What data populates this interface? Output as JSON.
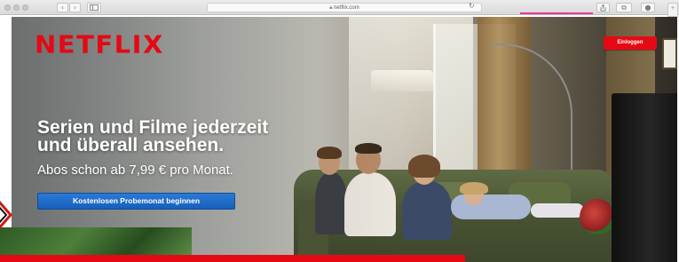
{
  "browser": {
    "url": "netflix.com",
    "back_icon": "chevron-left-icon",
    "forward_icon": "chevron-right-icon",
    "sidebar_icon": "sidebar-icon",
    "share_icon": "share-icon",
    "tabs_icon": "tabs-icon",
    "reload_icon": "reload-icon"
  },
  "header": {
    "logo": "NETFLIX",
    "login_label": "Einloggen"
  },
  "hero": {
    "headline_line1": "Serien und Filme jederzeit",
    "headline_line2": "und überall ansehen.",
    "subline": "Abos schon ab 7,99 € pro Monat.",
    "cta_label": "Kostenlosen Probemonat beginnen"
  },
  "colors": {
    "brand": "#e50914",
    "cta": "#1b6ac9",
    "accent": "#e8379c"
  }
}
